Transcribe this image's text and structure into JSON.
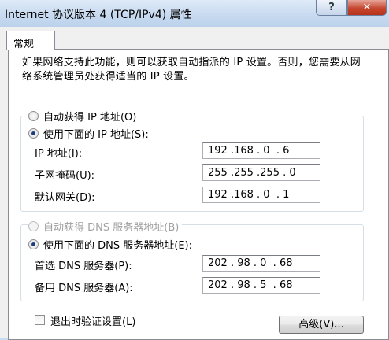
{
  "window": {
    "title": "Internet 协议版本 4 (TCP/IPv4) 属性",
    "help_label": "?",
    "close_label": "✕"
  },
  "tab": {
    "label": "常规"
  },
  "description": "如果网络支持此功能，则可以获取自动指派的 IP 设置。否则，您需要从网络系统管理员处获得适当的 IP 设置。",
  "ip": {
    "auto_label": "自动获得 IP 地址(O)",
    "manual_label": "使用下面的 IP 地址(S):",
    "selected": "manual",
    "fields": [
      {
        "label": "IP 地址(I):",
        "value": "192 .168 . 0  . 6"
      },
      {
        "label": "子网掩码(U):",
        "value": "255 .255 .255 . 0"
      },
      {
        "label": "默认网关(D):",
        "value": "192 .168 . 0  . 1"
      }
    ]
  },
  "dns": {
    "auto_label": "自动获得 DNS 服务器地址(B)",
    "auto_enabled": false,
    "manual_label": "使用下面的 DNS 服务器地址(E):",
    "selected": "manual",
    "fields": [
      {
        "label": "首选 DNS 服务器(P):",
        "value": "202 . 98 . 0  . 68"
      },
      {
        "label": "备用 DNS 服务器(A):",
        "value": "202 . 98 . 5  . 68"
      }
    ]
  },
  "validate": {
    "label": "退出时验证设置(L)",
    "checked": false
  },
  "advanced_button": "高级(V)..."
}
